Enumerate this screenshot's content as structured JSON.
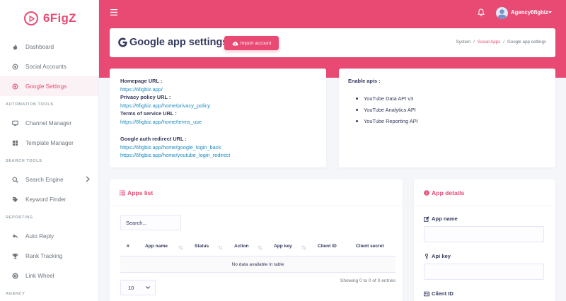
{
  "brand": {
    "name": "6FigZ",
    "color": "#e84a73"
  },
  "sidebar": {
    "items": [
      {
        "label": "Dashboard",
        "icon": "fire-icon"
      },
      {
        "label": "Social Accounts",
        "icon": "circle-dot-icon"
      },
      {
        "label": "Google Settings",
        "icon": "circle-dot-icon",
        "active": true
      }
    ],
    "sections": [
      {
        "title": "AUTOMATION TOOLS",
        "items": [
          {
            "label": "Channel Manager",
            "icon": "desktop-icon"
          },
          {
            "label": "Template Manager",
            "icon": "grid-icon"
          }
        ]
      },
      {
        "title": "SEARCH TOOLS",
        "items": [
          {
            "label": "Search Engine",
            "icon": "search-icon"
          },
          {
            "label": "Keyword Finder",
            "icon": "tag-icon"
          }
        ]
      },
      {
        "title": "REPORTING",
        "items": [
          {
            "label": "Auto Reply",
            "icon": "reply-icon"
          },
          {
            "label": "Rank Tracking",
            "icon": "trophy-icon"
          },
          {
            "label": "Link Wheel",
            "icon": "life-ring-icon"
          }
        ]
      },
      {
        "title": "AGENCY"
      }
    ]
  },
  "header": {
    "user_name": "Agency6figbiz"
  },
  "title_bar": {
    "title": "Google app settings",
    "import_label": "Import account",
    "breadcrumb": [
      "System",
      "Social Apps",
      "Google app settings"
    ]
  },
  "info": {
    "homepage_label": "Homepage URL :",
    "homepage_url": "https://6figbiz.app/",
    "privacy_label": "Privacy policy URL :",
    "privacy_url": "https://6figbiz.app/home/privacy_policy",
    "terms_label": "Terms of service URL :",
    "terms_url": "https://6figbiz.app/home/terms_use",
    "redirect_label": "Google auth redirect URL :",
    "redirect_urls": [
      "https://6figbiz.app/home/google_login_back",
      "https://6figbiz.app/home/youtube_login_redirect"
    ]
  },
  "apis": {
    "label": "Enable apis :",
    "items": [
      "YouTube Data API v3",
      "YouTube Analytics API",
      "YouTube Reporting API"
    ]
  },
  "apps_list": {
    "title": "Apps list",
    "search_placeholder": "Search...",
    "columns": [
      "#",
      "App name",
      "Status",
      "Action",
      "App key",
      "Client ID",
      "Client secret"
    ],
    "empty_text": "No data available in table",
    "showing": "Showing 0 to 0 of 0 entries",
    "page_length": "10"
  },
  "app_details": {
    "title": "App details",
    "fields": [
      "App name",
      "Api key",
      "Client ID"
    ]
  }
}
